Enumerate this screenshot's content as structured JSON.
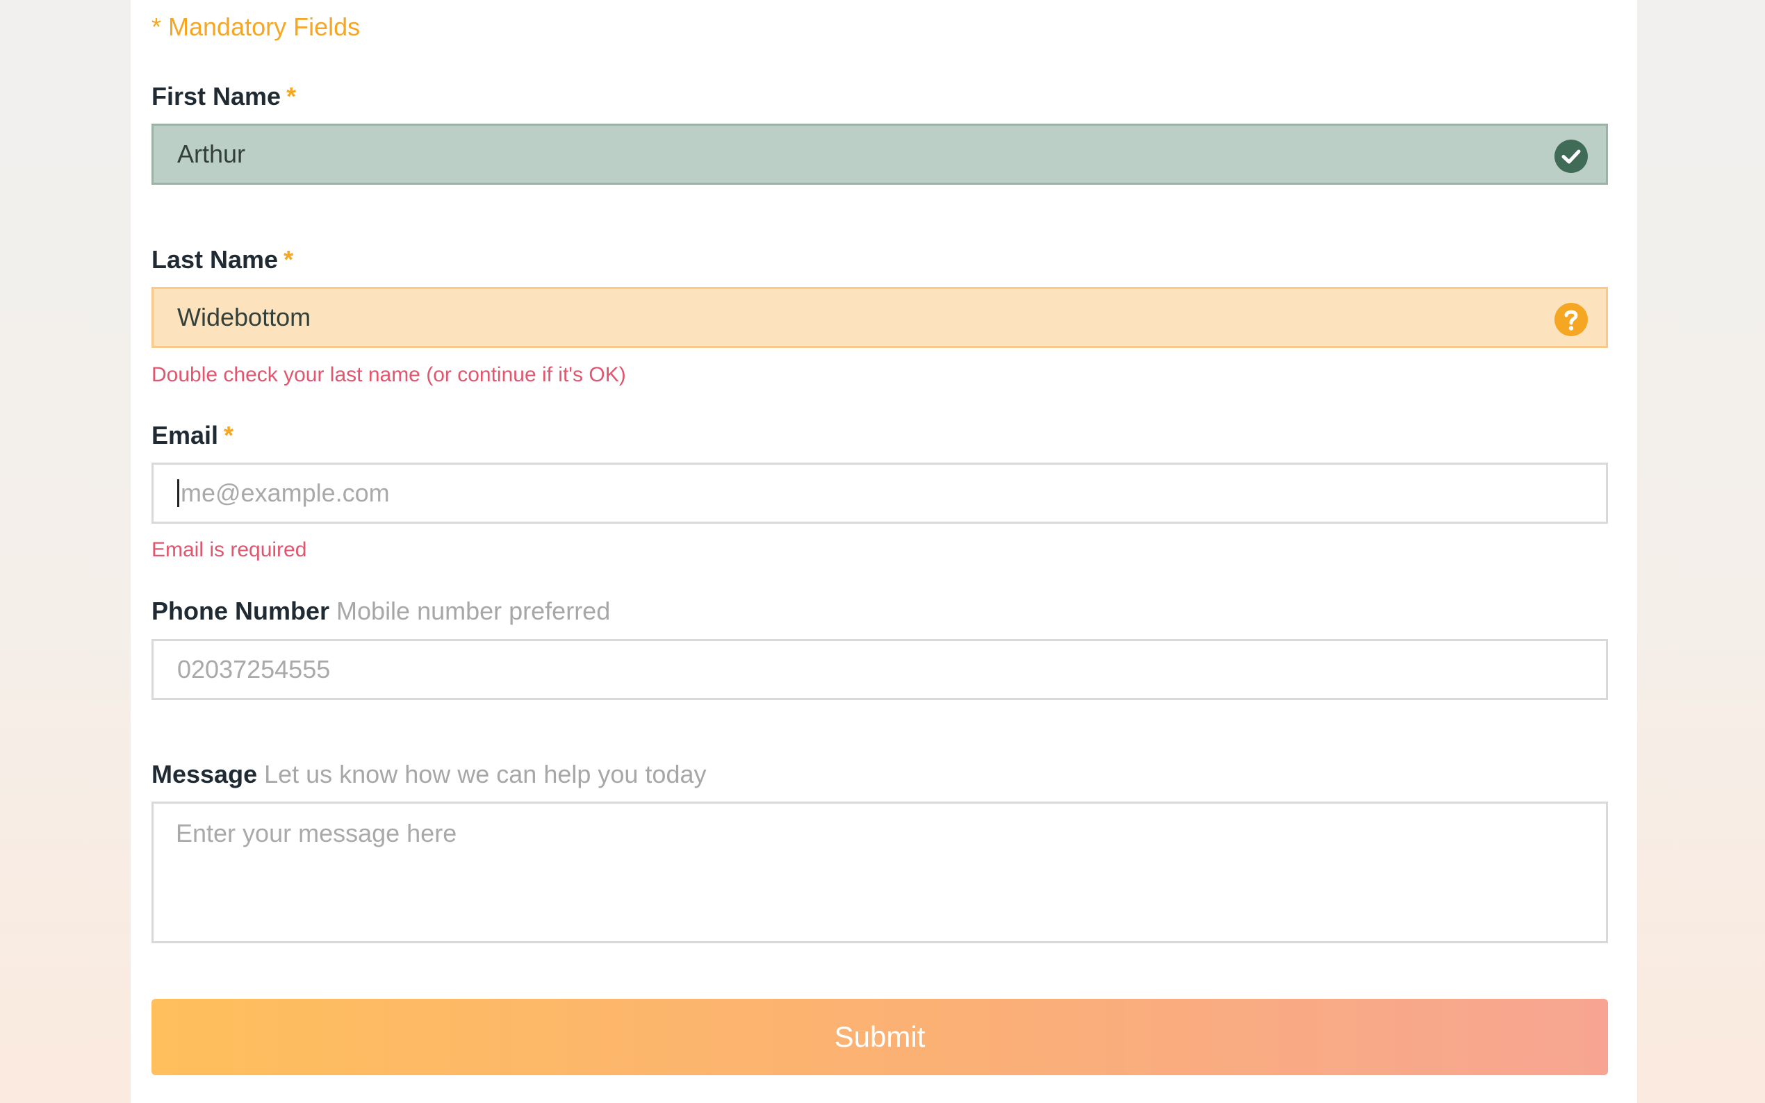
{
  "form": {
    "mandatory_note": "* Mandatory Fields",
    "first_name": {
      "label": "First Name",
      "required_mark": "*",
      "value": "Arthur",
      "status": "valid",
      "status_icon": "check-circle-icon",
      "status_color": "#3f6b57"
    },
    "last_name": {
      "label": "Last Name",
      "required_mark": "*",
      "value": "Widebottom",
      "status": "warning",
      "status_icon": "question-circle-icon",
      "status_color": "#f5a623",
      "message": "Double check your last name (or continue if it's OK)"
    },
    "email": {
      "label": "Email",
      "required_mark": "*",
      "value": "",
      "placeholder": "me@example.com",
      "status": "error",
      "message": "Email is required"
    },
    "phone": {
      "label": "Phone Number",
      "hint": "Mobile number preferred",
      "value": "",
      "placeholder": "02037254555"
    },
    "message": {
      "label": "Message",
      "hint": "Let us know how we can help you today",
      "value": "",
      "placeholder": "Enter your message here"
    },
    "submit_label": "Submit"
  },
  "colors": {
    "accent": "#f5a623",
    "error": "#e0566e",
    "valid_bg": "#bccfc6",
    "warning_bg": "#fde3bd"
  }
}
